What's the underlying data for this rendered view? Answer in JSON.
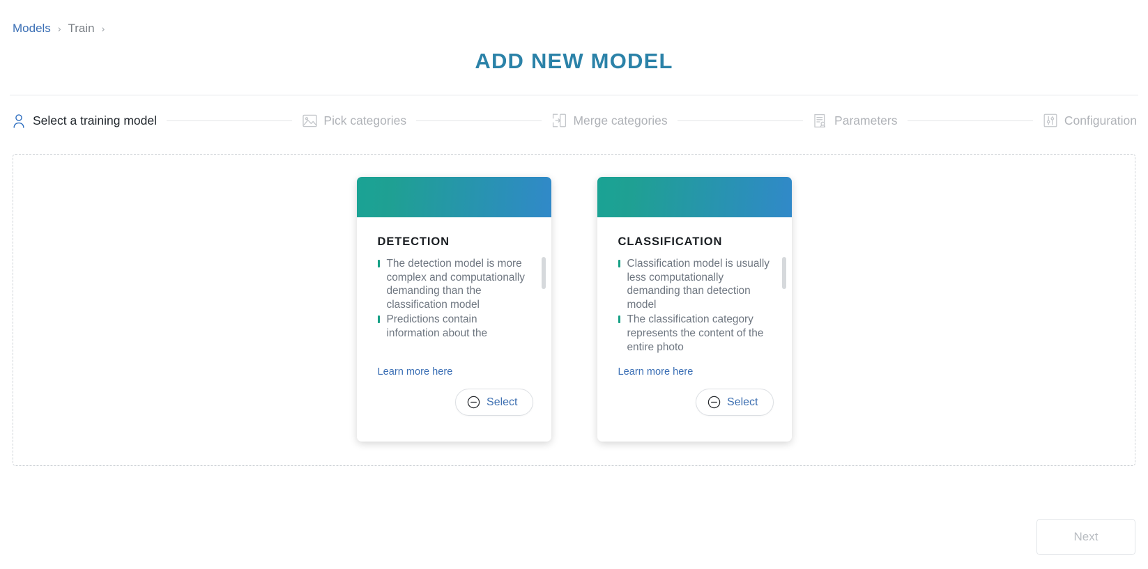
{
  "breadcrumb": {
    "items": [
      {
        "label": "Models",
        "current": false
      },
      {
        "label": "Train",
        "current": true
      }
    ],
    "separator": "›"
  },
  "header": {
    "title": "ADD NEW MODEL",
    "title_color": "#2b82a8"
  },
  "stepper": {
    "steps": [
      {
        "label": "Select a training model",
        "icon": "person-icon",
        "active": true
      },
      {
        "label": "Pick categories",
        "icon": "image-icon",
        "active": false
      },
      {
        "label": "Merge categories",
        "icon": "merge-icon",
        "active": false
      },
      {
        "label": "Parameters",
        "icon": "document-person-icon",
        "active": false
      },
      {
        "label": "Configuration",
        "icon": "sliders-icon",
        "active": false
      }
    ]
  },
  "cards": [
    {
      "title": "DETECTION",
      "bullets": [
        "The detection model is more complex and computationally demanding than the classification model",
        "Predictions contain information about the"
      ],
      "learn_more": "Learn more here",
      "select_label": "Select",
      "select_icon": "minus-circle-icon"
    },
    {
      "title": "CLASSIFICATION",
      "bullets": [
        "Classification model is usually less computationally demanding than detection model",
        "The classification category represents the content of the entire photo"
      ],
      "learn_more": "Learn more here",
      "select_label": "Select",
      "select_icon": "minus-circle-icon"
    }
  ],
  "footer": {
    "next_label": "Next",
    "next_disabled": true
  },
  "colors": {
    "accent_teal": "#16a085",
    "accent_blue": "#3189c9",
    "link_blue": "#3b6fb5",
    "muted_text": "#6e7680",
    "bullet_marker": "#16a085"
  }
}
